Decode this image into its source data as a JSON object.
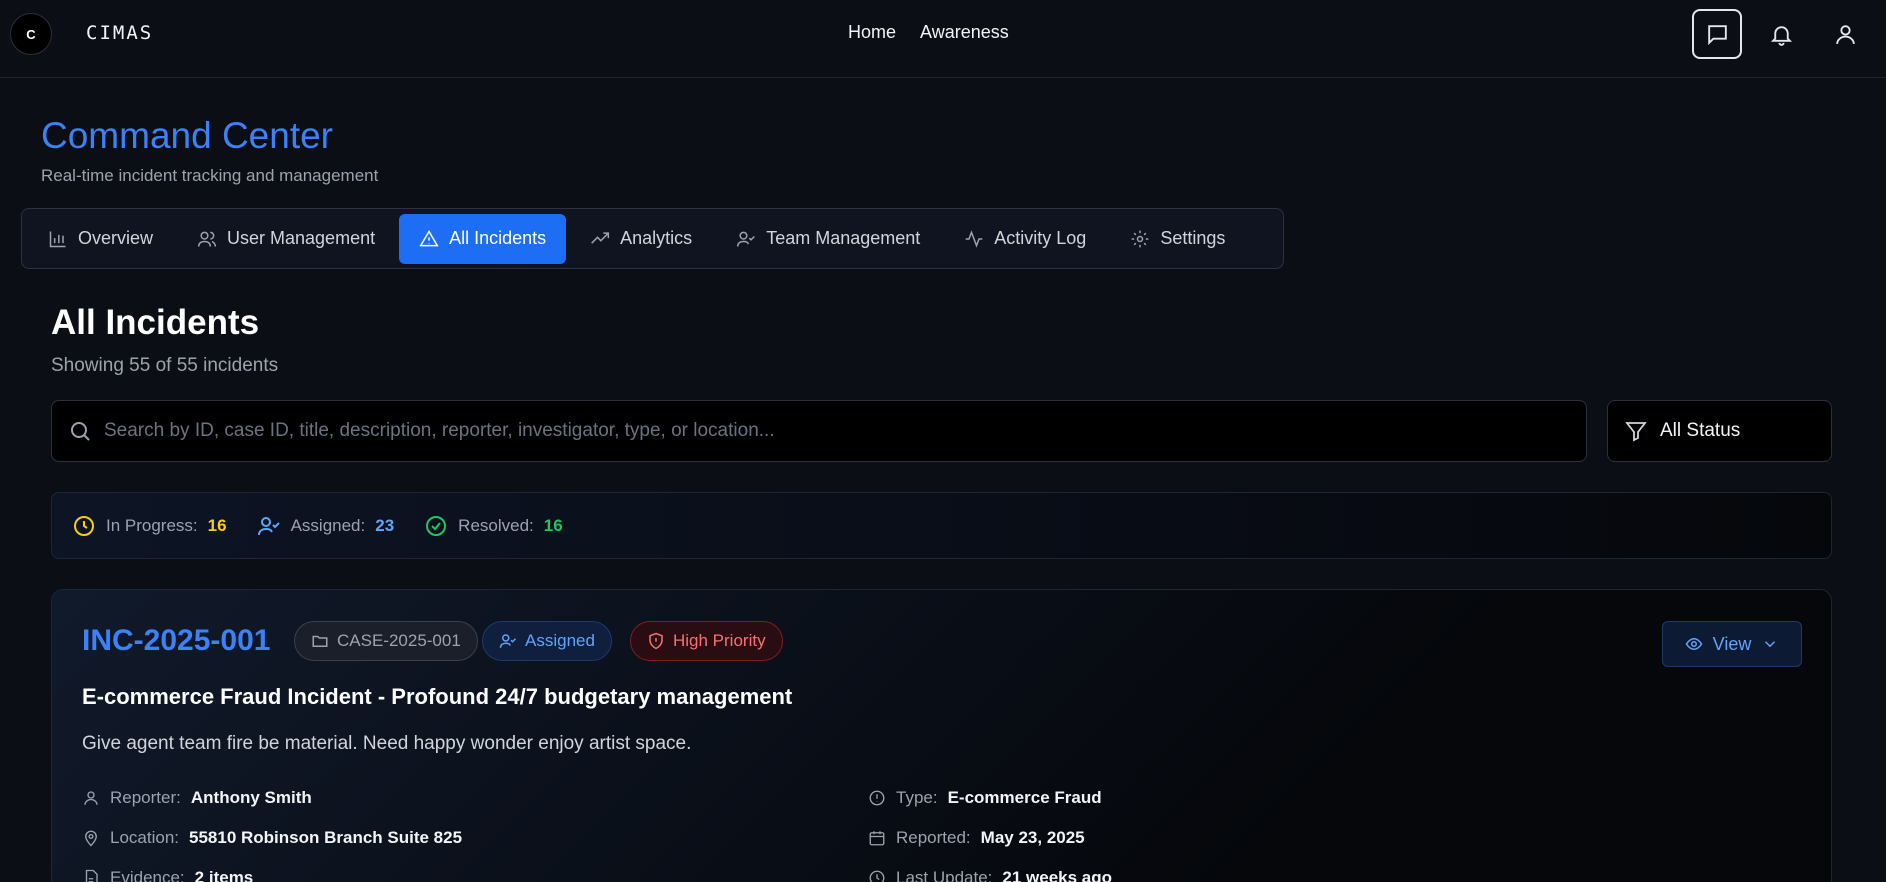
{
  "navbar": {
    "logo_text": "C",
    "brand": "CIMAS",
    "links": [
      "Home",
      "Awareness"
    ],
    "icons": [
      "message-icon",
      "bell-icon",
      "user-icon"
    ]
  },
  "header": {
    "title": "Command Center",
    "subtitle": "Real-time incident tracking and management"
  },
  "tabs": [
    {
      "label": "Overview",
      "icon": "bar-chart-icon"
    },
    {
      "label": "User Management",
      "icon": "users-icon"
    },
    {
      "label": "All Incidents",
      "icon": "alert-triangle-icon",
      "active": true
    },
    {
      "label": "Analytics",
      "icon": "trending-up-icon"
    },
    {
      "label": "Team Management",
      "icon": "user-check-icon"
    },
    {
      "label": "Activity Log",
      "icon": "activity-icon"
    },
    {
      "label": "Settings",
      "icon": "gear-icon"
    }
  ],
  "incidents": {
    "title": "All Incidents",
    "count_text": "Showing 55 of 55 incidents",
    "search_placeholder": "Search by ID, case ID, title, description, reporter, investigator, type, or location...",
    "filter_label": "All Status"
  },
  "stats": [
    {
      "label": "In Progress:",
      "value": "16",
      "color": "#facc15",
      "icon": "clock-icon"
    },
    {
      "label": "Assigned:",
      "value": "23",
      "color": "#60a5fa",
      "icon": "user-check-icon"
    },
    {
      "label": "Resolved:",
      "value": "16",
      "color": "#22c55e",
      "icon": "check-circle-icon"
    }
  ],
  "card": {
    "id": "INC-2025-001",
    "case_id": "CASE-2025-001",
    "status": "Assigned",
    "priority": "High Priority",
    "view_label": "View",
    "title": "E-commerce Fraud Incident - Profound 24/7 budgetary management",
    "description": "Give agent team fire be material. Need happy wonder enjoy artist space.",
    "meta_left": [
      {
        "key": "Reporter:",
        "value": "Anthony Smith",
        "icon": "user-icon"
      },
      {
        "key": "Location:",
        "value": "55810 Robinson Branch Suite 825",
        "icon": "map-pin-icon"
      },
      {
        "key": "Evidence:",
        "value": "2 items",
        "icon": "file-icon"
      }
    ],
    "meta_right": [
      {
        "key": "Type:",
        "value": "E-commerce Fraud",
        "icon": "alert-circle-icon"
      },
      {
        "key": "Reported:",
        "value": "May 23, 2025",
        "icon": "calendar-icon"
      },
      {
        "key": "Last Update:",
        "value": "21 weeks ago",
        "icon": "clock-icon"
      }
    ]
  }
}
